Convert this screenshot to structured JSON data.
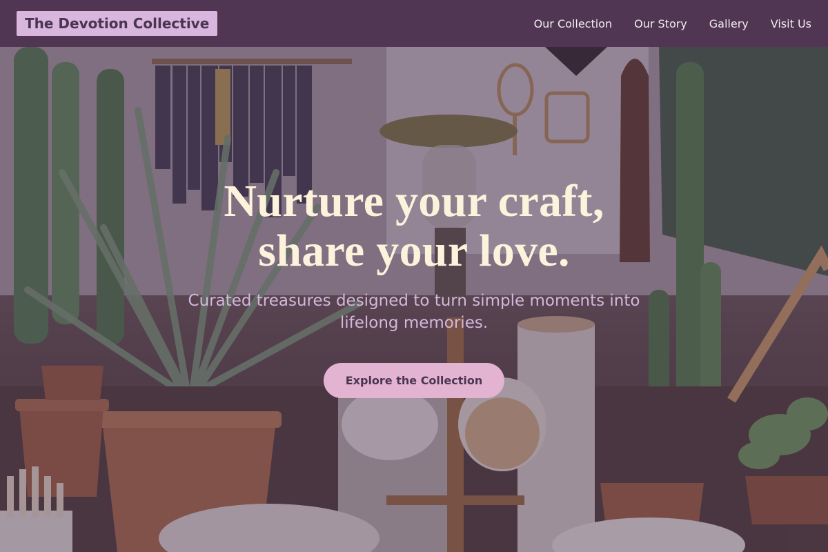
{
  "brand": {
    "name": "The Devotion Collective"
  },
  "nav": {
    "links": [
      {
        "label": "Our Collection"
      },
      {
        "label": "Our Story"
      },
      {
        "label": "Gallery"
      },
      {
        "label": "Visit Us"
      }
    ]
  },
  "hero": {
    "headline_line1": "Nurture your craft,",
    "headline_line2": "share your love.",
    "subtitle": "Curated treasures designed to turn simple moments into lifelong memories.",
    "cta_label": "Explore the Collection",
    "background_image": "shop interior with cacti, potted plants, clothing rack, lantern and mug stand"
  },
  "colors": {
    "navbar": "#4e3450",
    "brand_badge": "#d9b6dd",
    "headline": "#fdf3dc",
    "subtitle": "#d4b7dc",
    "cta_bg": "#e3b3d2",
    "cta_text": "#4a3550"
  }
}
